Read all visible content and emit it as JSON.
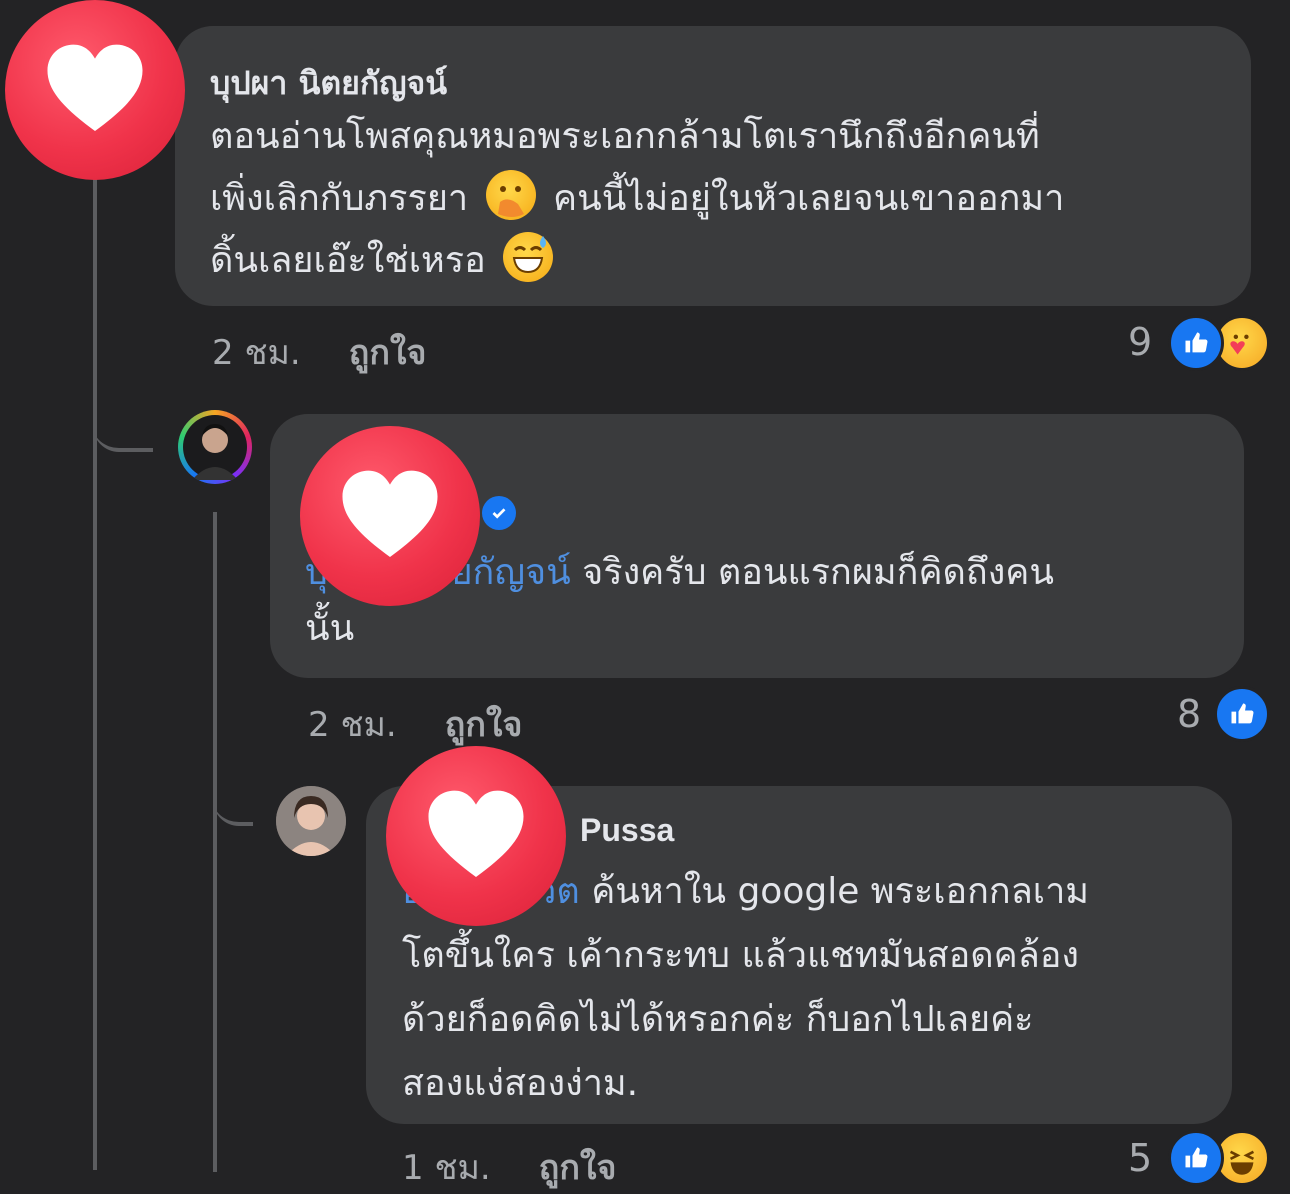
{
  "comments": [
    {
      "author": "บุปผา นิตยกัญจน์",
      "lines": [
        "ตอนอ่านโพสคุณหมอพระเอกกล้ามโตเรานึกถึงอีกคนที่",
        "เพิ่งเลิกกับภรรยา",
        "คนนี้ไม่อยู่ในหัวเลยจนเขาออกมา",
        "ดิ้นเลยเอ๊ะใช่เหรอ"
      ],
      "time": "2 ชม.",
      "like_label": "ถูกใจ",
      "reaction_count": "9"
    },
    {
      "mention": "บุปผา นิตยกัญจน์",
      "line1": "จริงครับ ตอนแรกผมก็คิดถึงคน",
      "line2": "นั้น",
      "time": "2 ชม.",
      "like_label": "ถูกใจ",
      "reaction_count": "8"
    },
    {
      "author": "Pussa",
      "mention": "อภิวัฒน์ วัต",
      "line1": "ค้นหาใน google พระเอกกลเาม",
      "line2": "โตขึ้นใคร เค้ากระทบ แล้วแชทมันสอดคล้อง",
      "line3": "ด้วยก็อดคิดไม่ได้หรอกค่ะ ก็บอกไปเลยค่ะ",
      "line4": "สองแง่สองง่าม.",
      "time": "1 ชม.",
      "like_label": "ถูกใจ",
      "reaction_count": "5"
    }
  ],
  "colors": {
    "background": "#232325",
    "bubble": "#3a3b3d",
    "mention": "#4f8fe0",
    "heart": "#f0334a",
    "like_blue": "#1877f2"
  },
  "icons": [
    "heart-icon",
    "like-icon",
    "care-icon",
    "haha-icon",
    "verified-icon",
    "emoji-hand-over-mouth",
    "emoji-grin-sweat"
  ]
}
